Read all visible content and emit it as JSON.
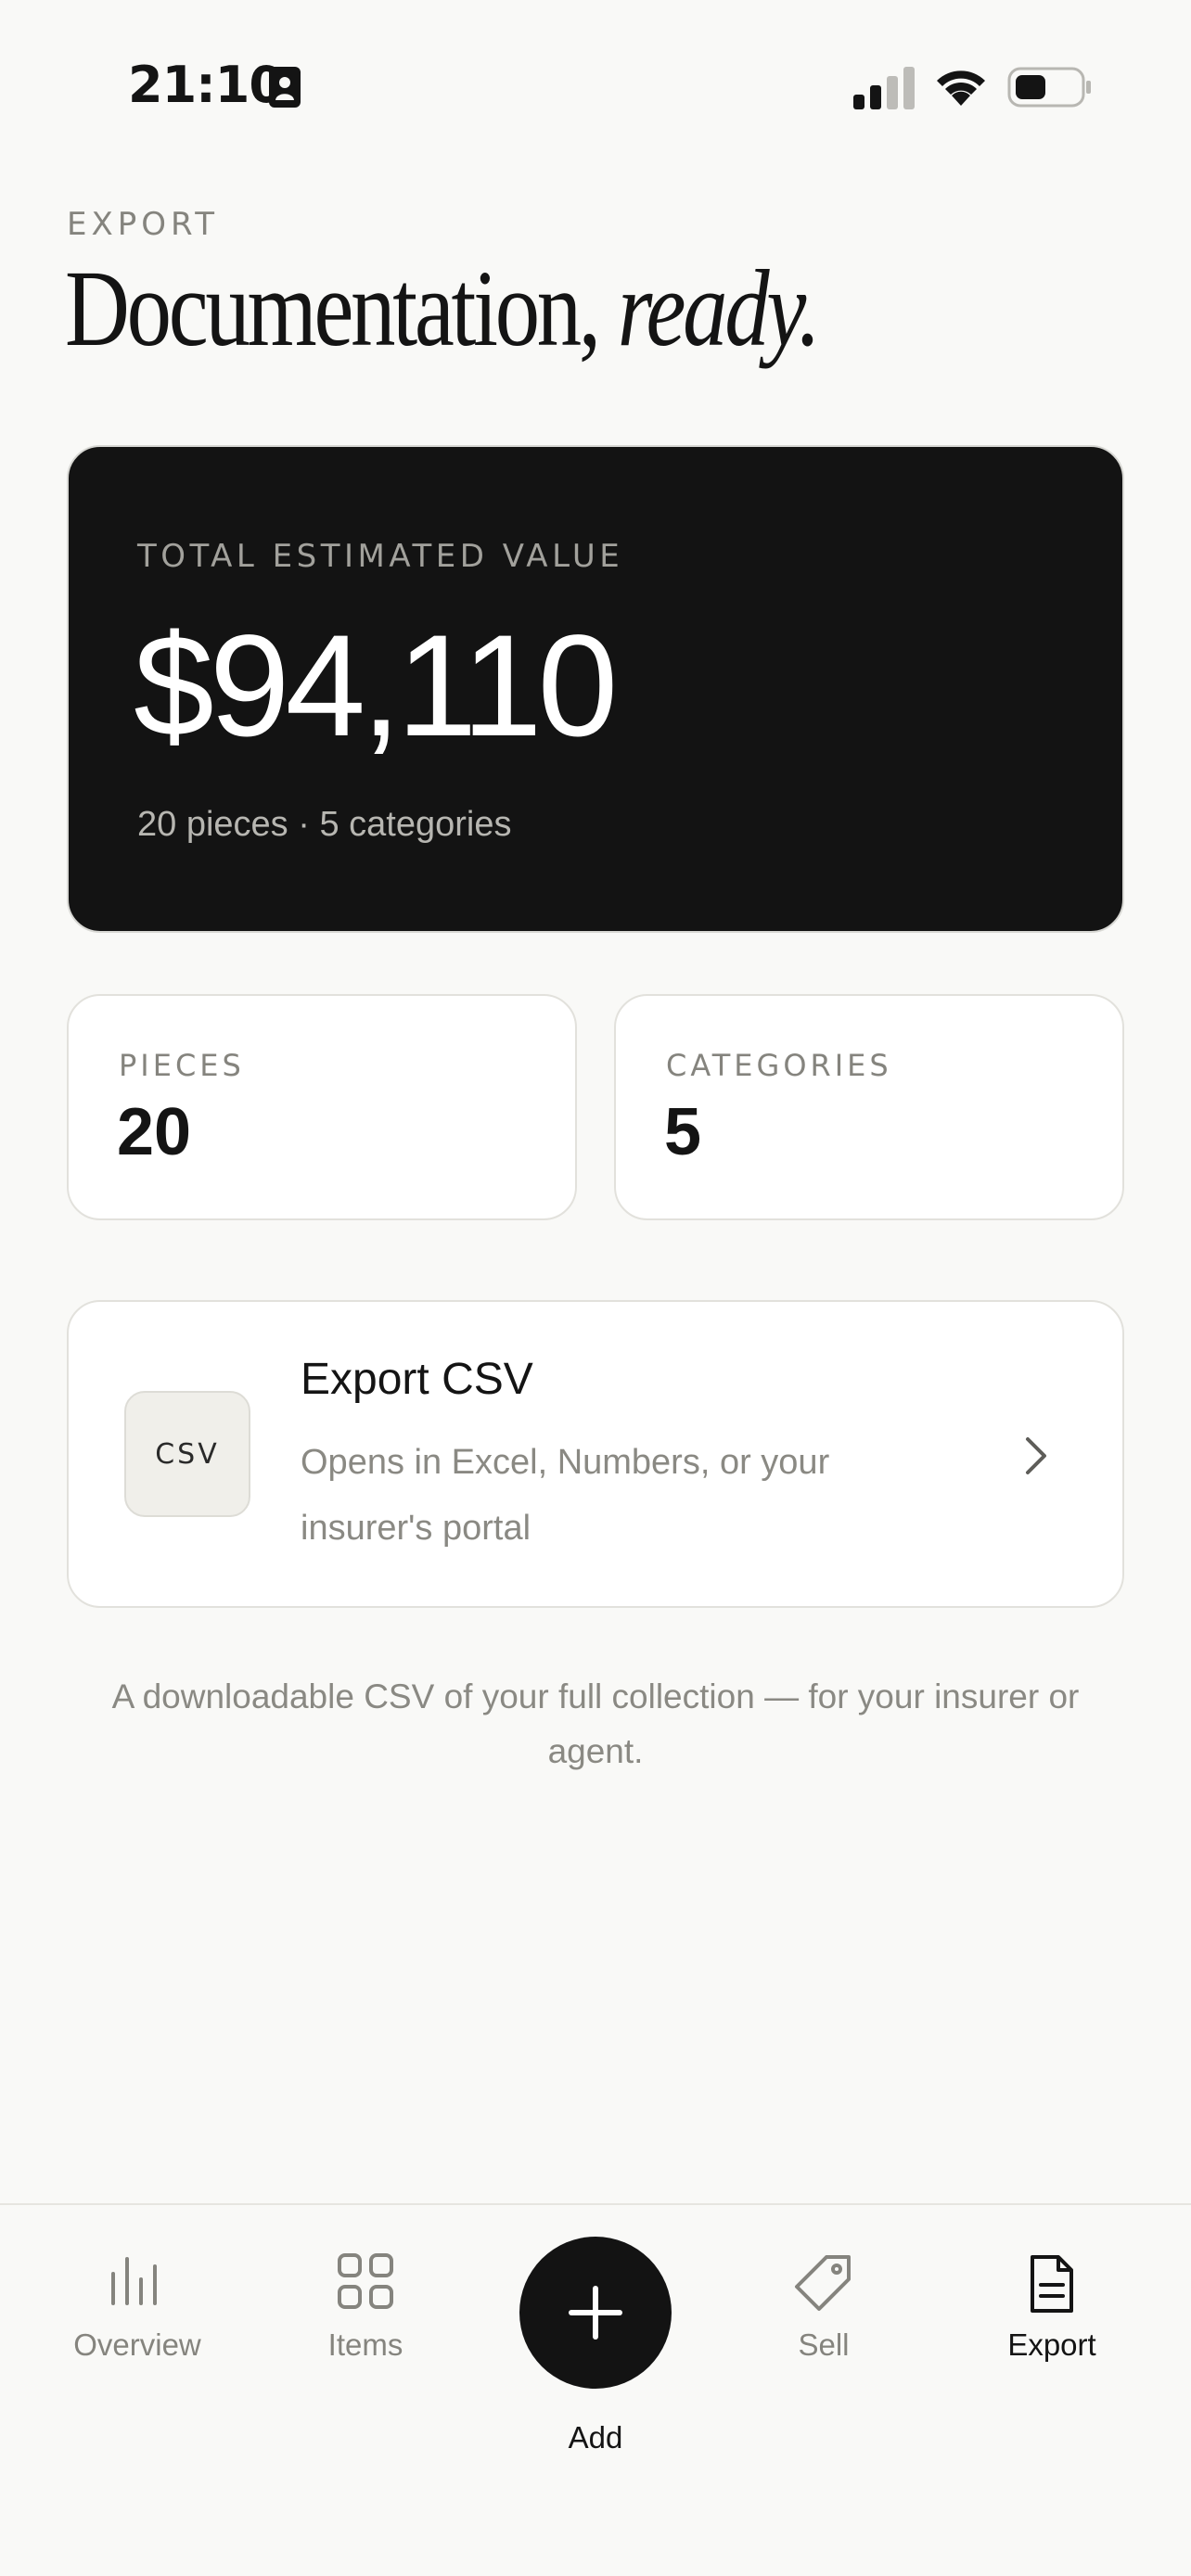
{
  "status_bar": {
    "time": "21:10"
  },
  "header": {
    "eyebrow": "EXPORT",
    "headline_regular": "Documentation, ",
    "headline_italic": "ready."
  },
  "summary": {
    "label": "TOTAL ESTIMATED VALUE",
    "value": "$94,110",
    "subtitle": "20 pieces · 5 categories"
  },
  "stats": {
    "pieces_label": "PIECES",
    "pieces_value": "20",
    "categories_label": "CATEGORIES",
    "categories_value": "5"
  },
  "export": {
    "badge": "CSV",
    "title": "Export CSV",
    "description": "Opens in Excel, Numbers, or your insurer's portal"
  },
  "footnote": "A downloadable CSV of your full collection — for your insurer or agent.",
  "tabs": {
    "overview": "Overview",
    "items": "Items",
    "add": "Add",
    "sell": "Sell",
    "export": "Export",
    "active": "export"
  },
  "colors": {
    "background": "#f9f9f7",
    "card_dark": "#131313",
    "muted_text": "#85847e"
  }
}
